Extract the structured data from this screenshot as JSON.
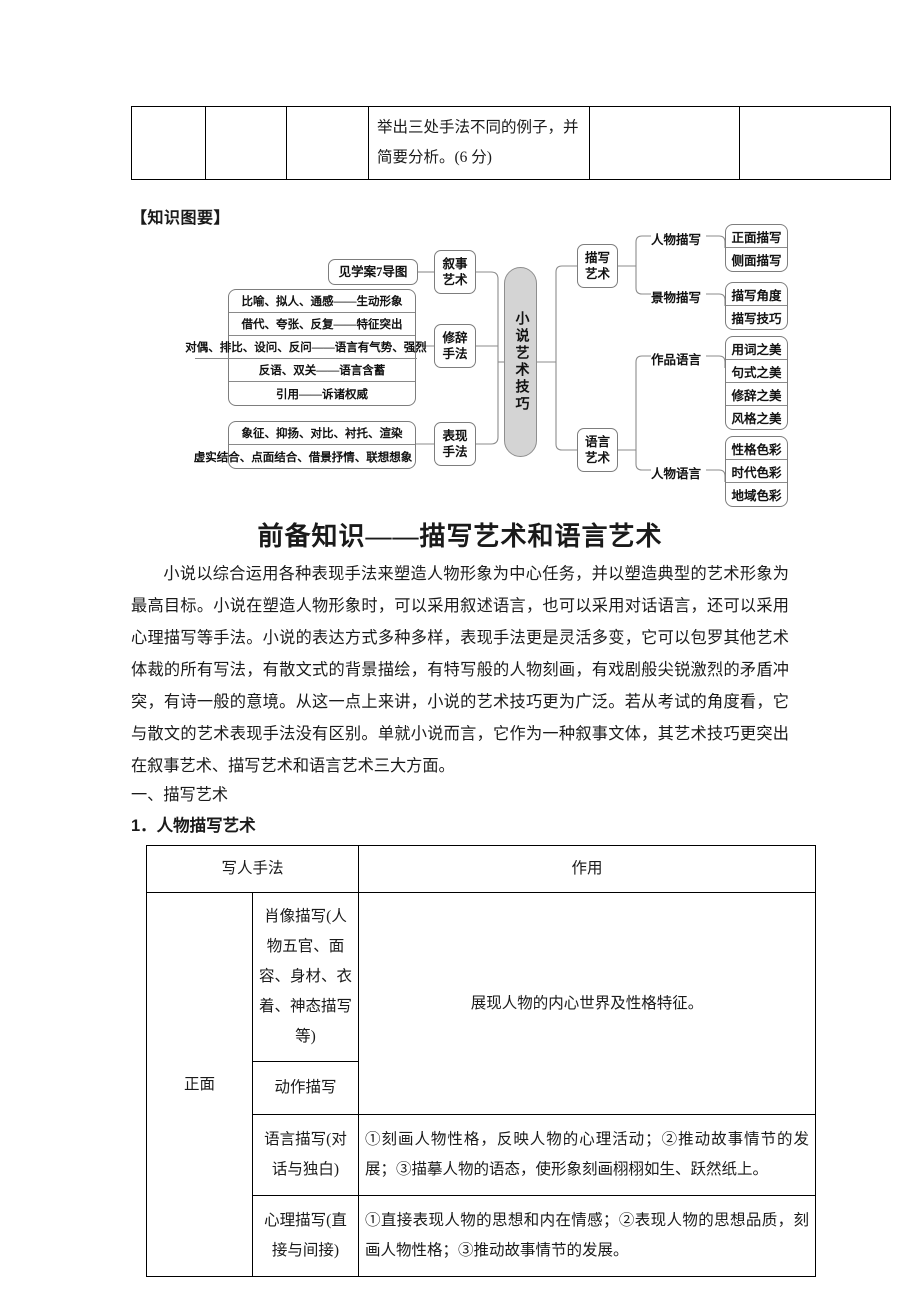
{
  "top_table": {
    "columns": 6,
    "cells": [
      "",
      "",
      "",
      "举出三处手法不同的例子，并简要分析。(6 分)",
      "",
      ""
    ]
  },
  "section_label": "【知识图要】",
  "diagram": {
    "center": "小说艺术技巧",
    "left_branches": [
      {
        "title": "叙事艺术",
        "source": "见学案7导图"
      },
      {
        "title": "修辞手法",
        "items": [
          "比喻、拟人、通感——生动形象",
          "借代、夸张、反复——特征突出",
          "对偶、排比、设问、反问——语言有气势、强烈",
          "反语、双关——语言含蓄",
          "引用——诉诸权威"
        ]
      },
      {
        "title": "表现手法",
        "items": [
          "象征、抑扬、对比、衬托、渲染",
          "虚实结合、点面结合、借景抒情、联想想象"
        ]
      }
    ],
    "right_branches": [
      {
        "title": "描写艺术",
        "groups": [
          {
            "label": "人物描写",
            "items": [
              "正面描写",
              "侧面描写"
            ]
          },
          {
            "label": "景物描写",
            "items": [
              "描写角度",
              "描写技巧"
            ]
          }
        ]
      },
      {
        "title": "语言艺术",
        "groups": [
          {
            "label": "作品语言",
            "items": [
              "用词之美",
              "句式之美",
              "修辞之美",
              "风格之美"
            ]
          },
          {
            "label": "人物语言",
            "items": [
              "性格色彩",
              "时代色彩",
              "地域色彩"
            ]
          }
        ]
      }
    ]
  },
  "main_title": "前备知识——描写艺术和语言艺术",
  "paragraph": "小说以综合运用各种表现手法来塑造人物形象为中心任务，并以塑造典型的艺术形象为最高目标。小说在塑造人物形象时，可以采用叙述语言，也可以采用对话语言，还可以采用心理描写等手法。小说的表达方式多种多样，表现手法更是灵活多变，它可以包罗其他艺术体裁的所有写法，有散文式的背景描绘，有特写般的人物刻画，有戏剧般尖锐激烈的矛盾冲突，有诗一般的意境。从这一点上来讲，小说的艺术技巧更为广泛。若从考试的角度看，它与散文的艺术表现手法没有区别。单就小说而言，它作为一种叙事文体，其艺术技巧更突出在叙事艺术、描写艺术和语言艺术三大方面。",
  "heading_1": "一、描写艺术",
  "heading_2": "1．人物描写艺术",
  "bottom_table": {
    "headers": [
      "写人手法",
      "作用"
    ],
    "row_group_label": "正面",
    "rows": [
      {
        "method": "肖像描写(人物五官、面容、身材、衣着、神态描写等)",
        "effect": "展现人物的内心世界及性格特征。"
      },
      {
        "method": "动作描写",
        "effect": ""
      },
      {
        "method": "语言描写(对话与独白)",
        "effect": "①刻画人物性格，反映人物的心理活动；②推动故事情节的发展；③描摹人物的语态，使形象刻画栩栩如生、跃然纸上。"
      },
      {
        "method": "心理描写(直接与间接)",
        "effect": "①直接表现人物的思想和内在情感；②表现人物的思想品质，刻画人物性格；③推动故事情节的发展。"
      }
    ]
  }
}
